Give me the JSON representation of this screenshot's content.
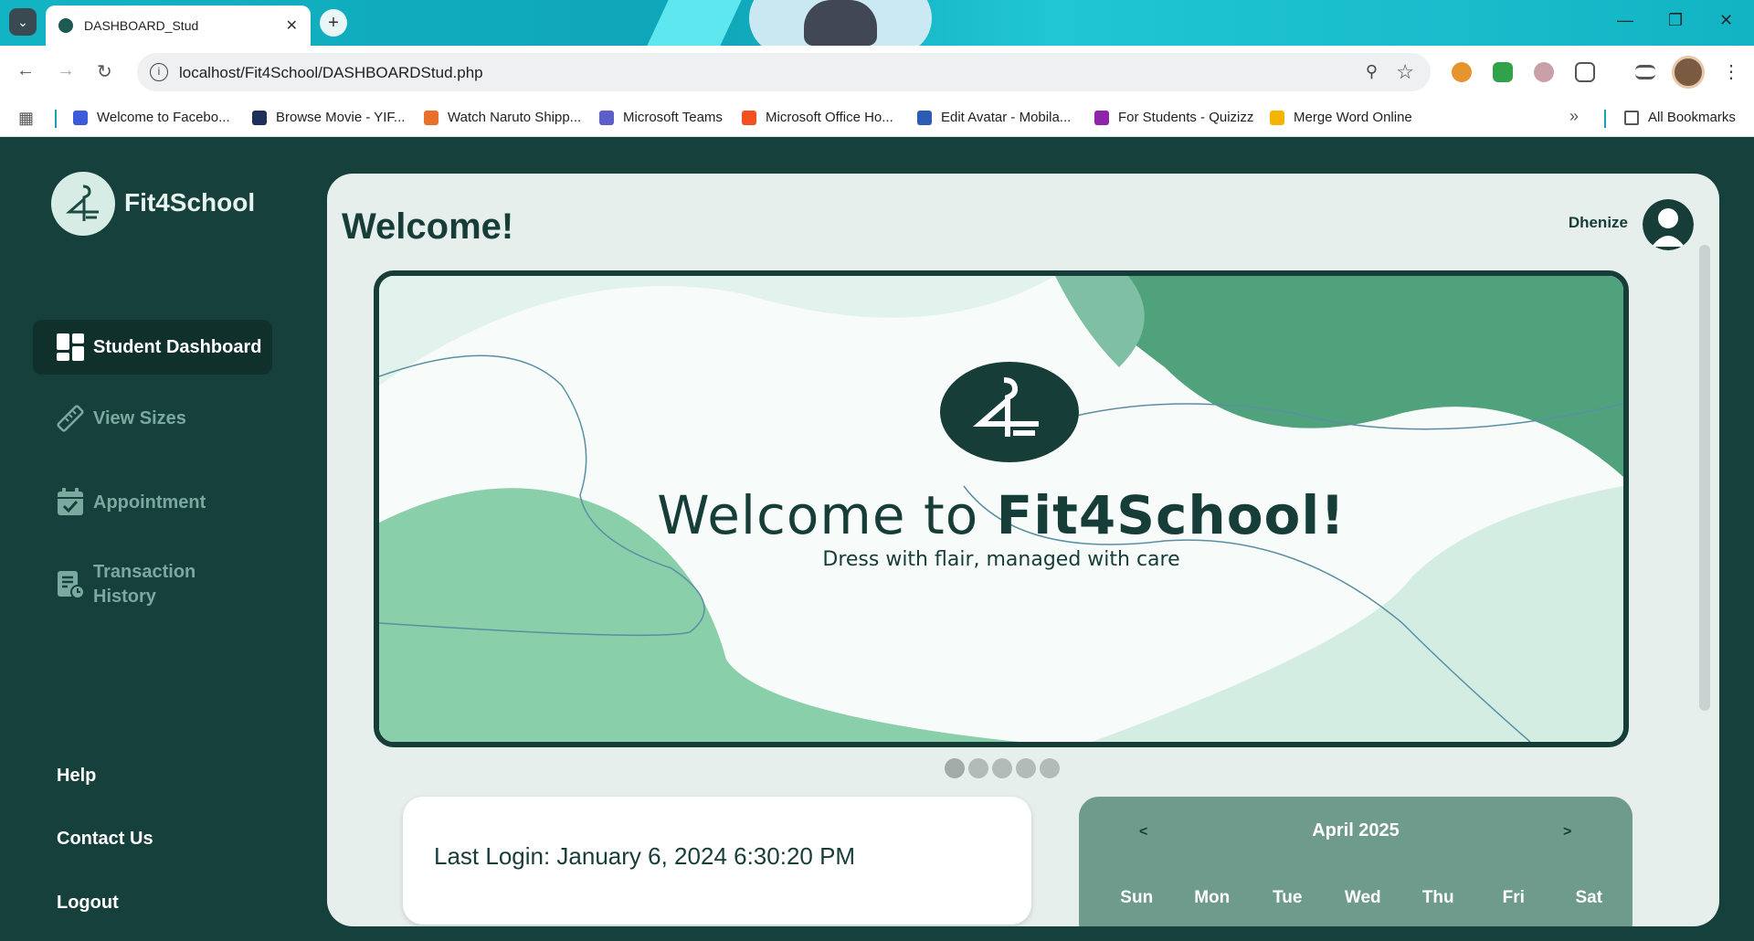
{
  "browser": {
    "tab_title": "DASHBOARD_Stud",
    "url": "localhost/Fit4School/DASHBOARDStud.php",
    "bookmarks": [
      {
        "label": "Welcome to Facebo...",
        "color": "#3b5bdb"
      },
      {
        "label": "Browse Movie - YIF...",
        "color": "#1d2f5a"
      },
      {
        "label": "Watch Naruto Shipp...",
        "color": "#e8702a"
      },
      {
        "label": "Microsoft Teams",
        "color": "#5b5fc7"
      },
      {
        "label": "Microsoft Office Ho...",
        "color": "#f25022"
      },
      {
        "label": "Edit Avatar - Mobila...",
        "color": "#2b5bb5"
      },
      {
        "label": "For Students - Quizizz",
        "color": "#8e24aa"
      },
      {
        "label": "Merge Word Online",
        "color": "#f4b400"
      }
    ],
    "all_bookmarks": "All Bookmarks"
  },
  "brand": {
    "name": "Fit4School"
  },
  "sidebar": {
    "items": [
      {
        "label": "Student Dashboard",
        "icon": "dashboard-icon"
      },
      {
        "label": "View Sizes",
        "icon": "ruler-icon"
      },
      {
        "label": "Appointment",
        "icon": "calendar-check-icon"
      },
      {
        "label": "Transaction History",
        "icon": "receipt-icon"
      }
    ],
    "footer": {
      "help": "Help",
      "contact": "Contact Us",
      "logout": "Logout"
    }
  },
  "main": {
    "heading": "Welcome!",
    "user_name": "Dhenize",
    "banner": {
      "title_regular": "Welcome to ",
      "title_bold": "Fit4School!",
      "subtitle": "Dress with flair, managed with care",
      "slide_count": 5,
      "active_slide": 0
    },
    "last_login": "Last Login: January 6, 2024 6:30:20 PM",
    "calendar": {
      "month": "April 2025",
      "prev": "<",
      "next": ">",
      "days": [
        "Sun",
        "Mon",
        "Tue",
        "Wed",
        "Thu",
        "Fri",
        "Sat"
      ]
    }
  },
  "colors": {
    "sidebar_bg": "#15403b",
    "main_bg": "#e6efec",
    "accent_green": "#4fa27c",
    "calendar_bg": "#6e9b8b"
  }
}
